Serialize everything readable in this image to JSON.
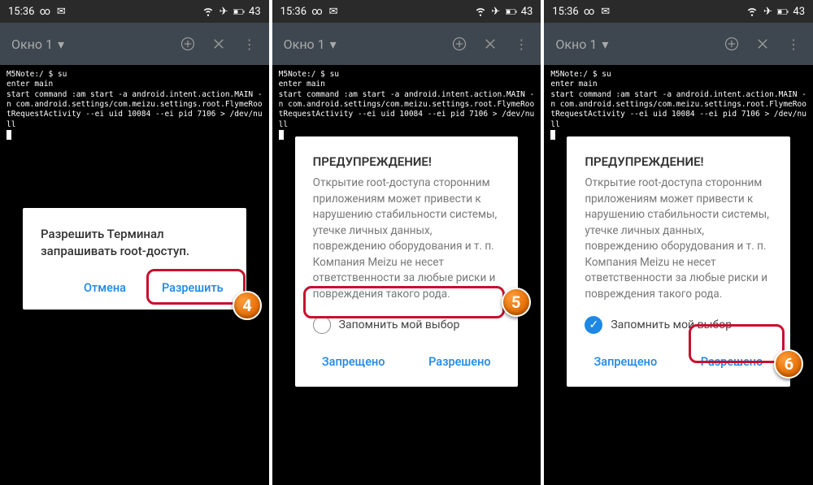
{
  "status": {
    "time": "15:36",
    "battery": "43"
  },
  "toolbar": {
    "title": "Окно 1"
  },
  "terminal": {
    "text": "M5Note:/ $ su\nenter main\nstart command :am start -a android.intent.action.MAIN -n com.android.settings/com.meizu.settings.root.FlymeRootRequestActivity --ei uid 10084 --ei pid 7106 > /dev/null"
  },
  "dialog_small": {
    "body": "Разрешить Терминал запрашивать root-доступ.",
    "cancel": "Отмена",
    "allow": "Разрешить"
  },
  "dialog_big": {
    "title": "ПРЕДУПРЕЖДЕНИЕ!",
    "body": "Открытие root-доступа сторонним приложениям может привести к нарушению стабильности системы, утечке личных данных, повреждению оборудования и т. п. Компания Meizu не несет ответственности за любые риски и повреждения такого рода.",
    "remember": "Запомнить мой выбор",
    "deny": "Запрещено",
    "allow": "Разрешено"
  },
  "badges": {
    "b4": "4",
    "b5": "5",
    "b6": "6"
  }
}
